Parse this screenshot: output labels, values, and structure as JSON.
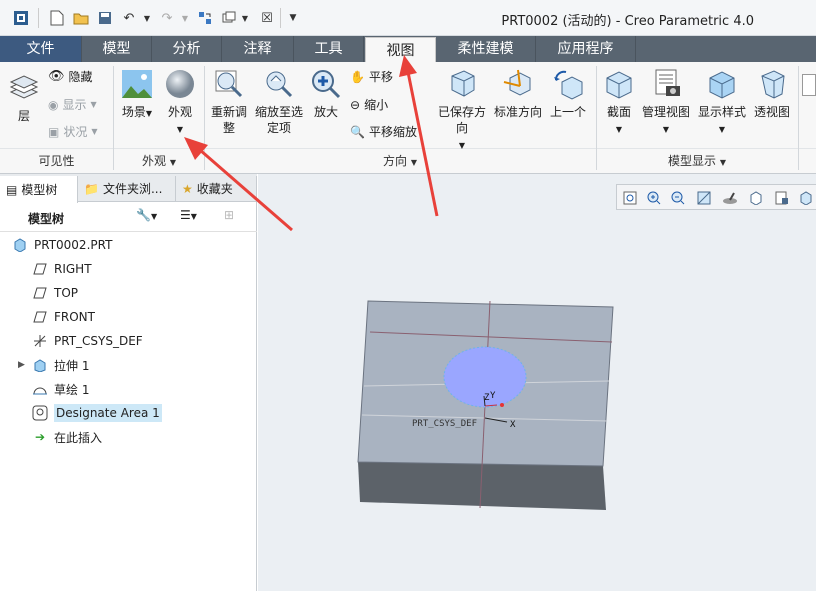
{
  "app_title": "PRT0002 (活动的) - Creo Parametric 4.0",
  "tabs": [
    "文件",
    "模型",
    "分析",
    "注释",
    "工具",
    "视图",
    "柔性建模",
    "应用程序"
  ],
  "active_tab": "视图",
  "ribbon": {
    "visibility": {
      "layer_label": "层",
      "hide_label": "隐藏",
      "show_label": "显示",
      "status_label": "状况",
      "group_label": "可见性"
    },
    "appearance": {
      "scene_label": "场景",
      "appearance_label": "外观",
      "group_label": "外观"
    },
    "orientation": {
      "refit_label": "重新调整",
      "zoom_selected_label": "缩放至选定项",
      "zoom_in_label": "放大",
      "pan_label": "平移",
      "zoom_out_label": "缩小",
      "pan_zoom_label": "平移缩放",
      "saved_orientations_label": "已保存方向",
      "standard_orientation_label": "标准方向",
      "previous_label": "上一个",
      "group_label": "方向"
    },
    "model_display": {
      "section_label": "截面",
      "manage_views_label": "管理视图",
      "display_style_label": "显示样式",
      "perspective_label": "透视图",
      "group_label": "模型显示"
    }
  },
  "left_panel": {
    "tabs": [
      "模型树",
      "文件夹浏...",
      "收藏夹"
    ],
    "tree_header": "模型树",
    "items": [
      {
        "label": "PRT0002.PRT",
        "icon": "part-icon"
      },
      {
        "label": "RIGHT",
        "icon": "datum-plane-icon"
      },
      {
        "label": "TOP",
        "icon": "datum-plane-icon"
      },
      {
        "label": "FRONT",
        "icon": "datum-plane-icon"
      },
      {
        "label": "PRT_CSYS_DEF",
        "icon": "csys-icon"
      },
      {
        "label": "拉伸 1",
        "icon": "extrude-icon"
      },
      {
        "label": "草绘 1",
        "icon": "sketch-icon"
      },
      {
        "label": "Designate Area 1",
        "icon": "designate-area-icon"
      },
      {
        "label": "在此插入",
        "icon": "insert-here-icon"
      }
    ]
  },
  "viewport": {
    "csys_label": "PRT_CSYS_DEF",
    "axis_x": "X",
    "axis_y": "Y",
    "axis_z": "Z",
    "colors": {
      "block_top": "#a9b3c1",
      "block_front": "#5c6269",
      "area_fill": "#9aa6ff",
      "annotation_arrow": "#e8413a"
    }
  }
}
